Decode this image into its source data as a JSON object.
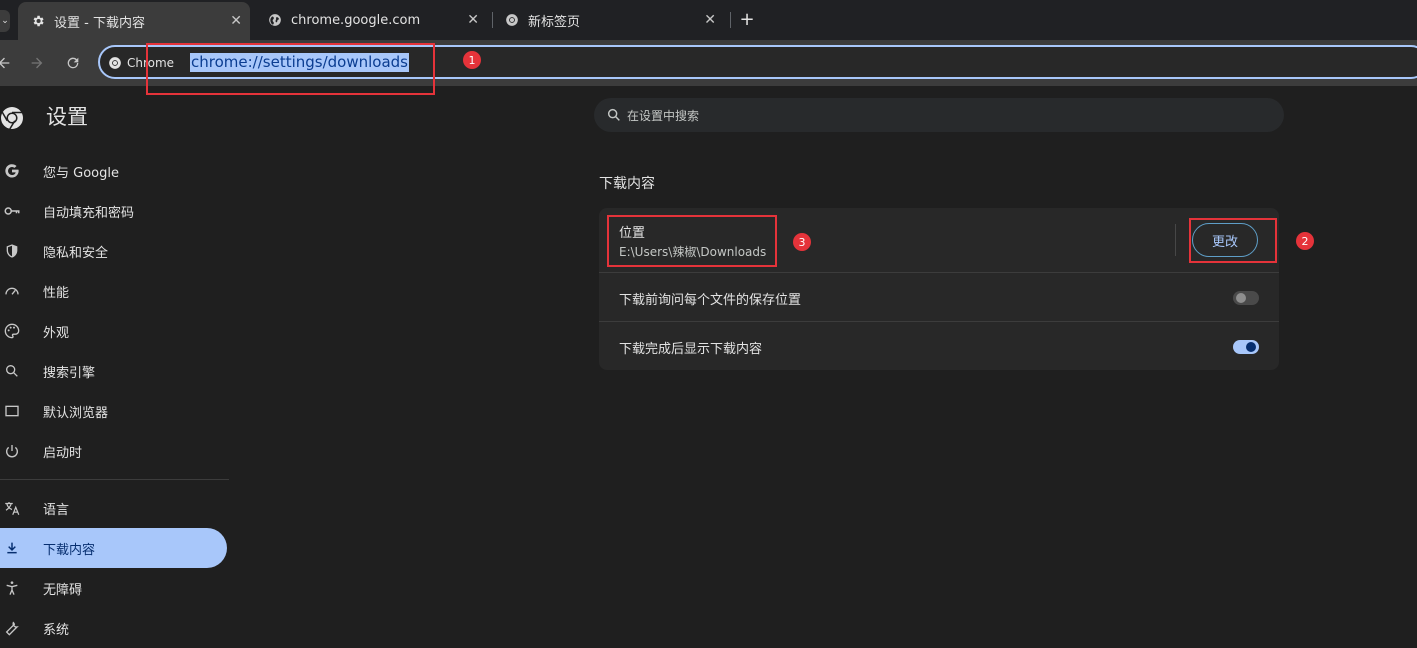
{
  "tabs": [
    {
      "title": "设置 - 下载内容",
      "icon": "gear-icon",
      "active": true
    },
    {
      "title": "chrome.google.com",
      "icon": "globe-icon",
      "active": false
    },
    {
      "title": "新标签页",
      "icon": "chrome-icon",
      "active": false
    }
  ],
  "tab_menu_glyph": "⌄",
  "tab_close_glyph": "✕",
  "new_tab_glyph": "+",
  "omnibox": {
    "chip_label": "Chrome",
    "url": "chrome://settings/downloads"
  },
  "annotations": [
    "1",
    "2",
    "3"
  ],
  "sidebar": {
    "title": "设置",
    "items": [
      {
        "label": "您与 Google",
        "icon": "google-g-icon"
      },
      {
        "label": "自动填充和密码",
        "icon": "key-icon"
      },
      {
        "label": "隐私和安全",
        "icon": "shield-icon"
      },
      {
        "label": "性能",
        "icon": "speedometer-icon"
      },
      {
        "label": "外观",
        "icon": "palette-icon"
      },
      {
        "label": "搜索引擎",
        "icon": "search-icon"
      },
      {
        "label": "默认浏览器",
        "icon": "browser-window-icon"
      },
      {
        "label": "启动时",
        "icon": "power-icon"
      },
      {
        "label": "语言",
        "icon": "translate-icon"
      },
      {
        "label": "下载内容",
        "icon": "download-icon",
        "active": true
      },
      {
        "label": "无障碍",
        "icon": "accessibility-icon"
      },
      {
        "label": "系统",
        "icon": "wrench-icon"
      }
    ]
  },
  "search": {
    "placeholder": "在设置中搜索"
  },
  "downloads": {
    "section_title": "下载内容",
    "location_label": "位置",
    "location_path": "E:\\Users\\辣椒\\Downloads",
    "change_button": "更改",
    "ask_label": "下载前询问每个文件的保存位置",
    "ask_enabled": false,
    "show_label": "下载完成后显示下载内容",
    "show_enabled": true
  },
  "colors": {
    "accent": "#a8c7fa",
    "annotation_red": "#e5333a",
    "background": "#1f1f1f"
  }
}
